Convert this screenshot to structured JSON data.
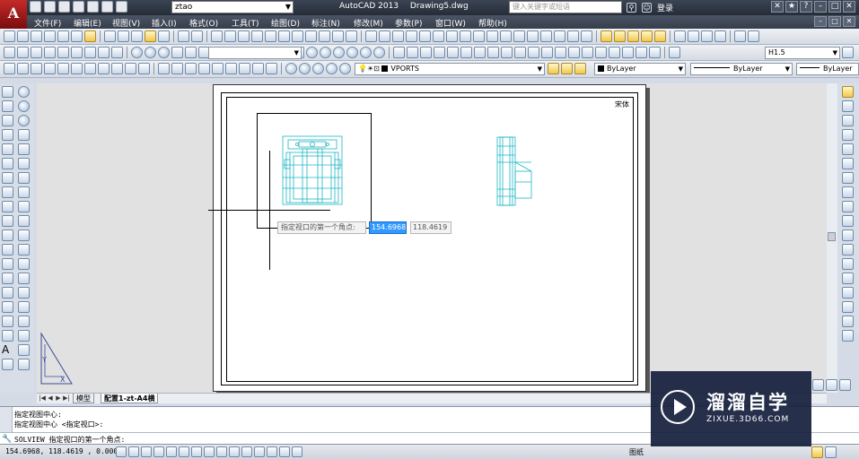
{
  "app": {
    "logo_letter": "A",
    "workspace": "ztao",
    "product": "AutoCAD 2013",
    "document": "Drawing5.dwg",
    "search_placeholder": "键入关键字或短语",
    "login": "登录",
    "help_icon": "?"
  },
  "menu": [
    "文件(F)",
    "编辑(E)",
    "视图(V)",
    "插入(I)",
    "格式(O)",
    "工具(T)",
    "绘图(D)",
    "标注(N)",
    "修改(M)",
    "参数(P)",
    "窗口(W)",
    "帮助(H)"
  ],
  "toolbar": {
    "textstyle_value": "H1.5",
    "layer_value": "VPORTS",
    "color_value": "ByLayer",
    "linetype_value": "ByLayer",
    "lineweight_value": "ByLayer"
  },
  "canvas": {
    "stamp_text": "宋体",
    "tooltip_prompt": "指定视口的第一个角点:",
    "tooltip_x": "154.6968",
    "tooltip_y": "118.4619"
  },
  "tabs": [
    "模型",
    "配置1-zt-A4横"
  ],
  "active_tab_index": 1,
  "command_history": [
    "指定视图中心:",
    "指定视图中心 <指定视口>:"
  ],
  "command_prompt": "SOLVIEW 指定视口的第一个角点:",
  "status": {
    "coords": "154.6968,  118.4619 , 0.0000",
    "paper_label": "图纸"
  },
  "watermark": {
    "title": "溜溜自学",
    "url": "ZIXUE.3D66.COM"
  },
  "colors": {
    "titlebar": "#2e3542",
    "drawing_cyan": "#1bb6c4",
    "highlight": "#3399ff"
  }
}
